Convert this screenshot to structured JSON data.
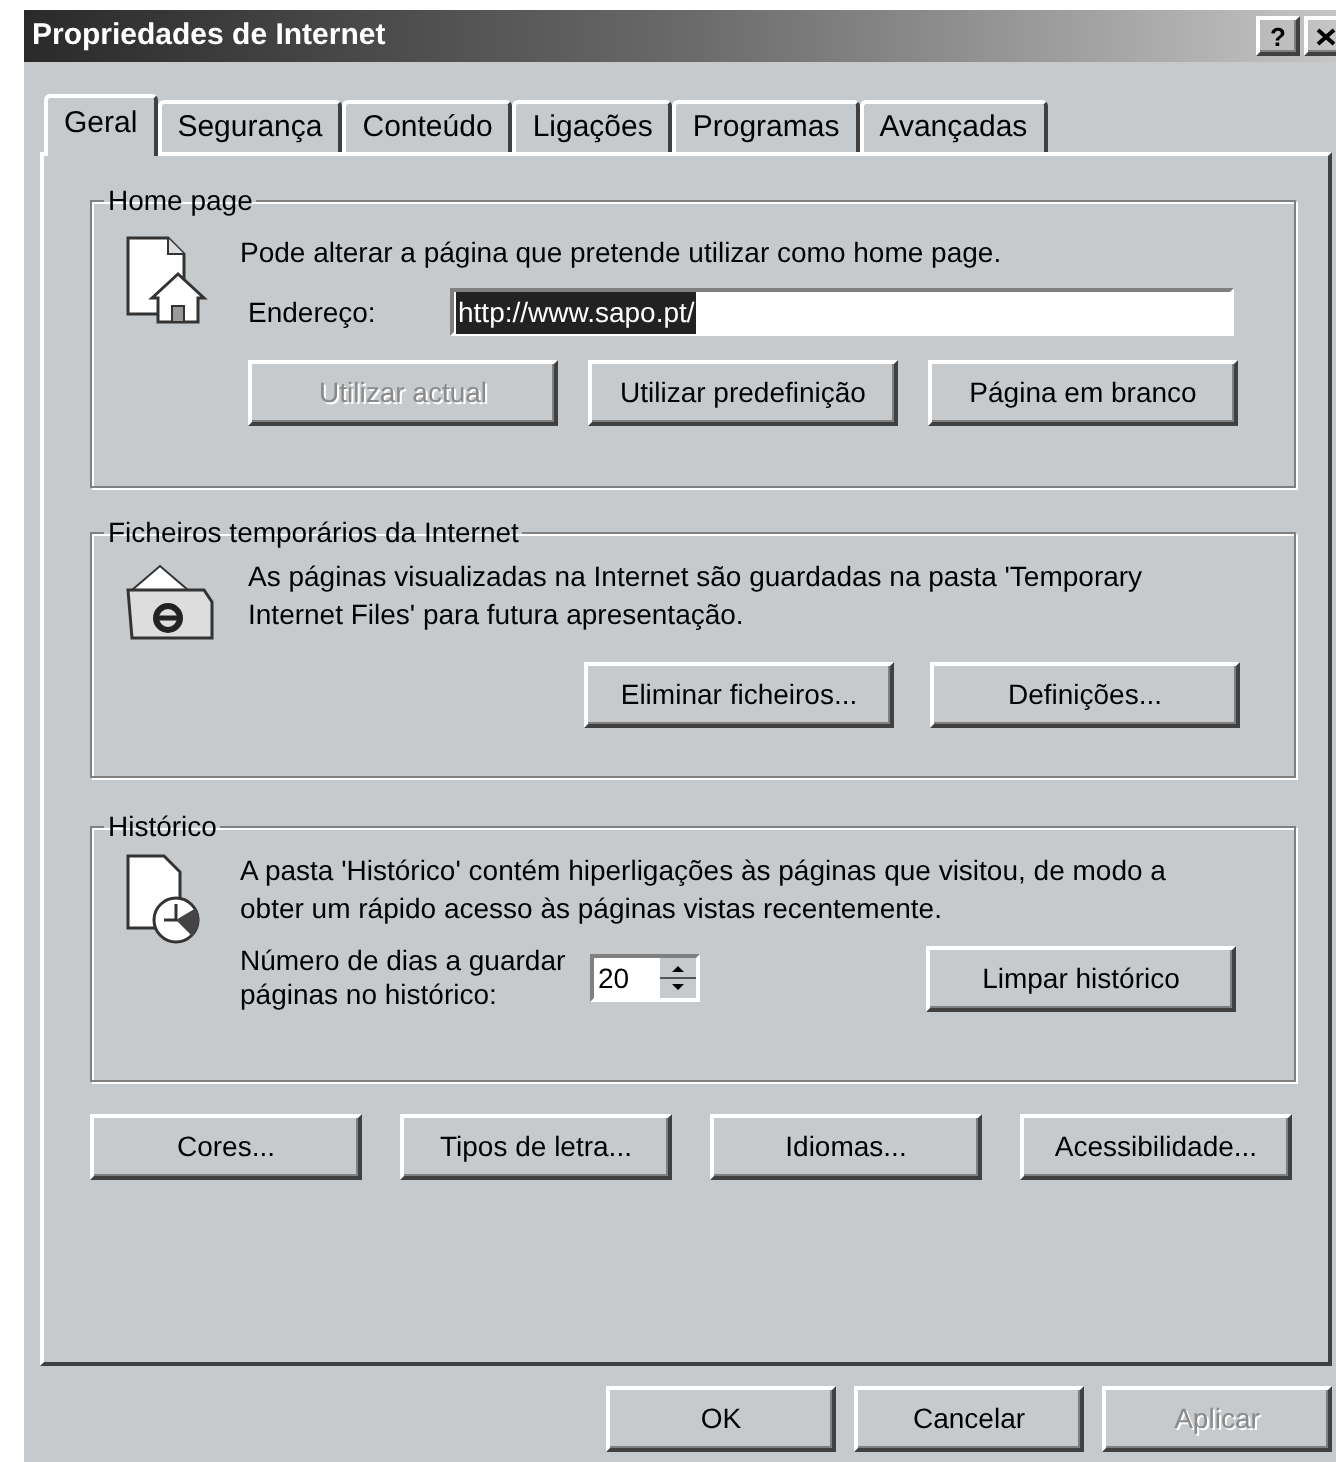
{
  "window": {
    "title": "Propriedades de Internet",
    "help_button": "?"
  },
  "tabs": [
    {
      "label": "Geral",
      "selected": true
    },
    {
      "label": "Segurança",
      "selected": false
    },
    {
      "label": "Conteúdo",
      "selected": false
    },
    {
      "label": "Ligações",
      "selected": false
    },
    {
      "label": "Programas",
      "selected": false
    },
    {
      "label": "Avançadas",
      "selected": false
    }
  ],
  "home_page": {
    "title": "Home page",
    "description": "Pode alterar a página que pretende utilizar como home page.",
    "address_label": "Endereço:",
    "address_value": "http://www.sapo.pt/",
    "value_highlighted": true,
    "buttons": [
      {
        "label": "Utilizar actual",
        "disabled": true
      },
      {
        "label": "Utilizar predefinição",
        "disabled": false
      },
      {
        "label": "Página em branco",
        "disabled": false
      }
    ]
  },
  "temporary_files": {
    "title": "Ficheiros temporários da Internet",
    "description": "As páginas visualizadas na Internet são guardadas na pasta 'Temporary Internet Files' para futura apresentação.",
    "buttons": [
      {
        "label": "Eliminar ficheiros...",
        "disabled": false
      },
      {
        "label": "Definições...",
        "disabled": false
      }
    ]
  },
  "history": {
    "title": "Histórico",
    "description": "A pasta 'Histórico' contém hiperligações às páginas que visitou, de modo a obter um rápido acesso às páginas vistas recentemente.",
    "days_label": "Número de dias a guardar páginas no histórico:",
    "days_value": "20",
    "button": {
      "label": "Limpar histórico",
      "disabled": false
    }
  },
  "bottom_buttons": [
    {
      "label": "Cores...",
      "disabled": false
    },
    {
      "label": "Tipos de letra...",
      "disabled": false
    },
    {
      "label": "Idiomas...",
      "disabled": false
    },
    {
      "label": "Acessibilidade...",
      "disabled": false
    }
  ],
  "dialog_buttons": [
    {
      "label": "OK",
      "disabled": false
    },
    {
      "label": "Cancelar",
      "disabled": false
    },
    {
      "label": "Aplicar",
      "disabled": true
    }
  ]
}
